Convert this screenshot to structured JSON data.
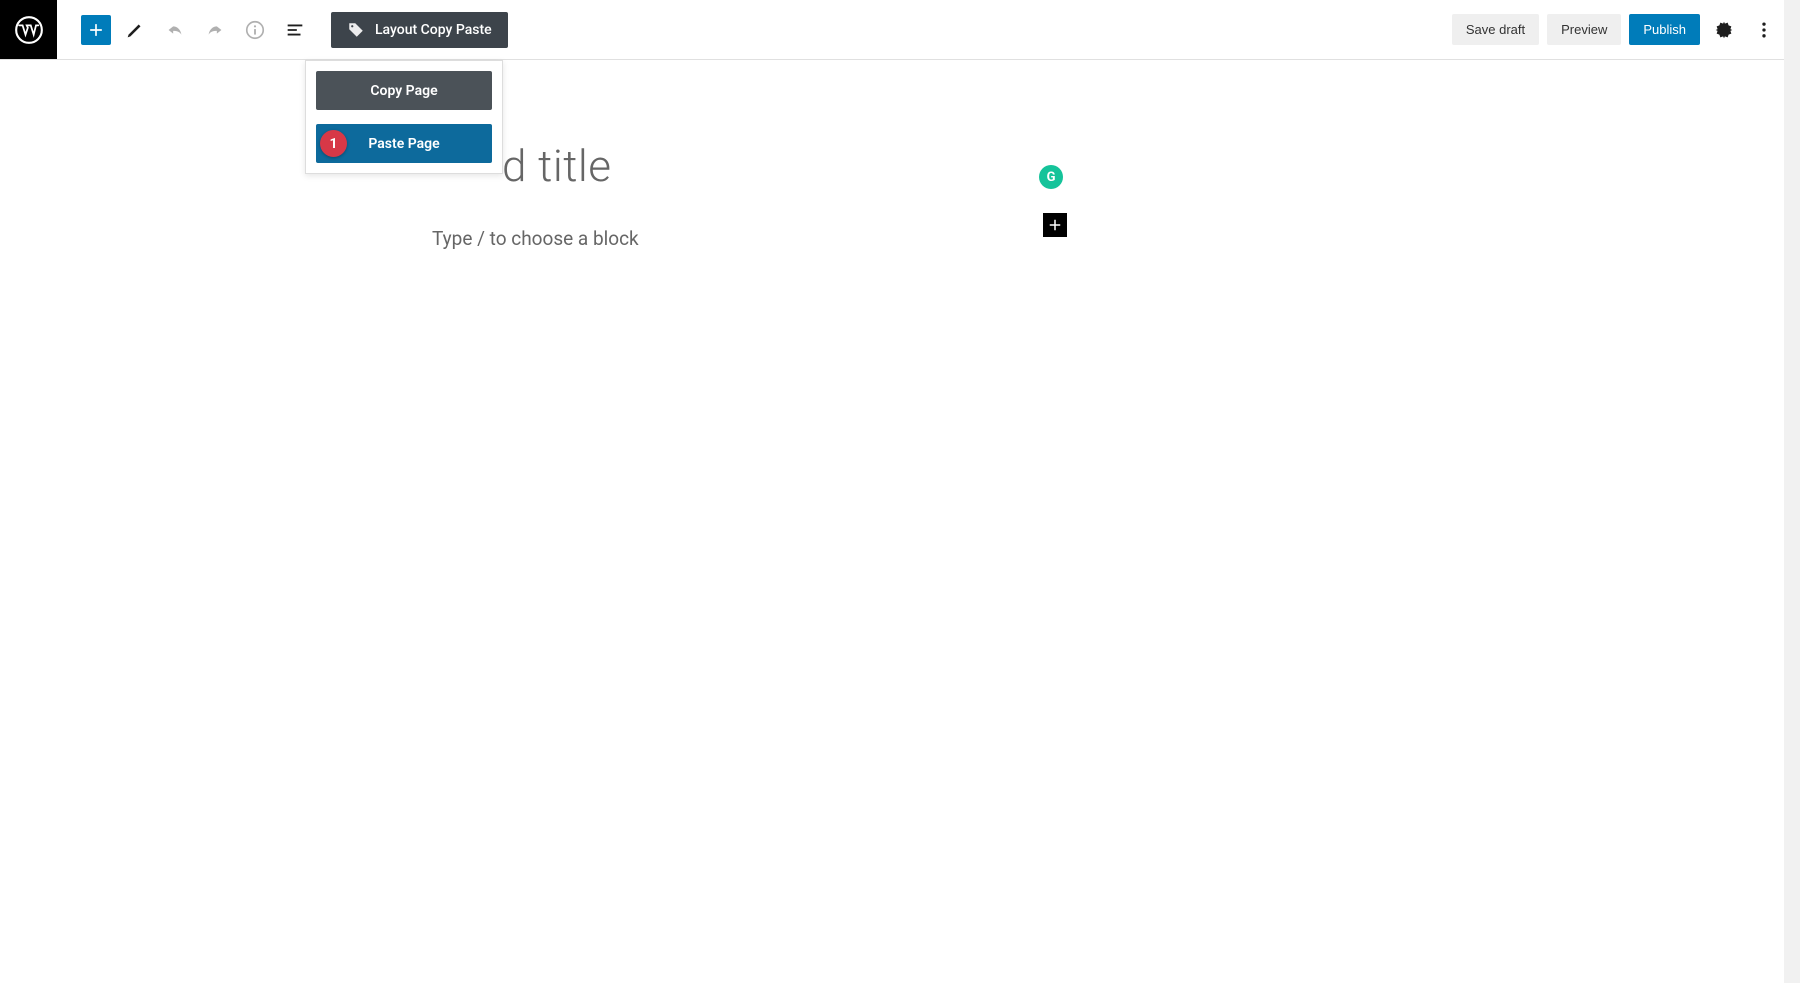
{
  "toolbar": {
    "layout_copy_paste": "Layout Copy Paste",
    "save_draft": "Save draft",
    "preview": "Preview",
    "publish": "Publish"
  },
  "dropdown": {
    "copy_page": "Copy Page",
    "paste_page": "Paste Page",
    "step_number": "1"
  },
  "editor": {
    "title_placeholder": "d title",
    "block_placeholder": "Type / to choose a block"
  },
  "badges": {
    "grammarly": "G"
  }
}
